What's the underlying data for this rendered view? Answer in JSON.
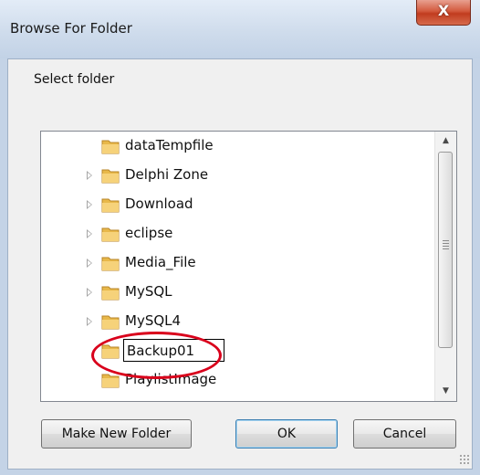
{
  "window": {
    "title": "Browse For Folder",
    "close_glyph": "X"
  },
  "prompt": "Select folder",
  "tree": {
    "items": [
      {
        "label": "dataTempfile",
        "has_expander": false
      },
      {
        "label": "Delphi Zone",
        "has_expander": true
      },
      {
        "label": "Download",
        "has_expander": true
      },
      {
        "label": "eclipse",
        "has_expander": true
      },
      {
        "label": "Media_File",
        "has_expander": true
      },
      {
        "label": "MySQL",
        "has_expander": true
      },
      {
        "label": "MySQL4",
        "has_expander": true
      },
      {
        "label": "",
        "editing": true,
        "edit_value": "Backup01"
      },
      {
        "label": "PlaylistImage",
        "has_expander": false
      }
    ],
    "scroll_up_glyph": "▲",
    "scroll_down_glyph": "▼"
  },
  "buttons": {
    "make_new_folder": "Make New Folder",
    "ok": "OK",
    "cancel": "Cancel"
  },
  "colors": {
    "highlight": "#d9001b",
    "folder": "#e8b84a"
  }
}
